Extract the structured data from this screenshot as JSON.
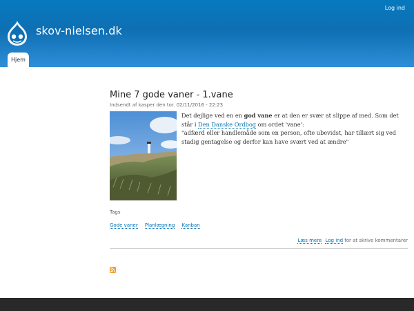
{
  "header": {
    "login_label": "Log ind",
    "site_name": "skov-nielsen.dk",
    "logo_icon": "drupal-drop-icon",
    "gradient_top": "#0779bf",
    "gradient_bottom": "#2e8ed8"
  },
  "nav": {
    "tabs": [
      {
        "label": "Hjem",
        "active": true
      }
    ]
  },
  "article": {
    "title": "Mine 7 gode vaner - 1.vane",
    "submitted": "Indsendt af kasper den tor. 02/11/2016 - 22:23",
    "image_icon": "lighthouse-dunes-photo",
    "text": {
      "p1_a": "Det dejlige ved en en ",
      "p1_bold": "god vane",
      "p1_b": " er at den er svær at slippe af med. Som det står i ",
      "p1_link": "Den Danske Ordbog",
      "p1_c": " om ordet 'vane':",
      "quote": "\"adfærd eller handlemåde som en person, ofte ubevidst, har tillært sig ved stadig gentagelse og derfor kan have svært ved at ændre\""
    },
    "tags_label": "Tags",
    "tags": [
      "Gode vaner",
      "Planlægning",
      "Kanban"
    ],
    "read_more": "Læs mere",
    "login_link": "Log ind",
    "comment_text": "for at skrive kommentarer"
  },
  "feed": {
    "icon": "rss-icon"
  },
  "colors": {
    "link": "#0071b3",
    "footer": "#292929",
    "rss": "#f39c2e"
  }
}
